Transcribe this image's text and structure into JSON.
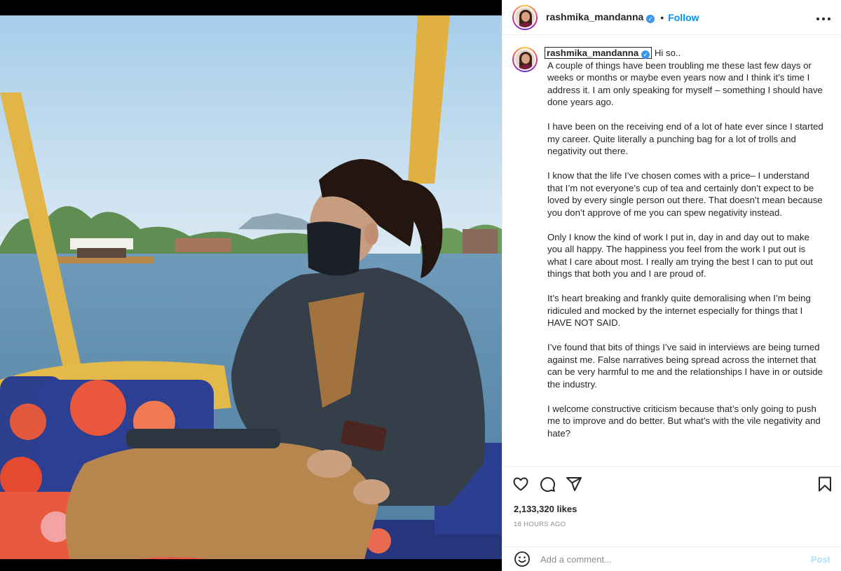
{
  "post": {
    "username": "rashmika_mandanna",
    "verified_mark": "✓",
    "dot": "•",
    "follow_label": "Follow",
    "more_icon": "more-dots-icon"
  },
  "caption": {
    "username": "rashmika_mandanna",
    "greeting": "Hi so..",
    "paragraphs": [
      "A couple of things have been troubling me these last few days or weeks or months or maybe even years now and I think it’s time I address it. I am only speaking for myself – something I should have done years ago.",
      "I have been on the receiving end of a lot of hate ever since I started my career. Quite literally a punching bag for a lot of trolls and negativity out there.",
      "I know that the life I’ve chosen comes with a price– I understand that I’m not everyone’s cup of tea and certainly don’t expect to be loved by every single person out there. That doesn’t mean because you don’t approve of me you can spew negativity instead.",
      "Only I know the kind of work I put in, day in and day out to make you all happy. The happiness you feel from the work I put out is what I care about most. I really am trying the best I can to put out things that both you and I are proud of.",
      "It’s heart breaking and frankly quite demoralising when I’m being ridiculed and mocked by the internet especially for things that I HAVE NOT SAID.",
      "I’ve found that bits of things I’ve said in interviews are being turned against me. False narratives being spread across the internet that can be very harmful to me and the relationships I have in or outside the industry.",
      "I welcome constructive criticism because that’s only going to push me to improve and do better. But what’s with the vile negativity and hate?"
    ]
  },
  "actions": {
    "like_icon": "heart-icon",
    "comment_icon": "comment-icon",
    "share_icon": "share-icon",
    "save_icon": "bookmark-icon"
  },
  "likes": "2,133,320 likes",
  "time": "18 HOURS AGO",
  "comment_box": {
    "placeholder": "Add a comment...",
    "post_label": "Post"
  },
  "colors": {
    "accent": "#0095f6",
    "post_disabled": "#b2dffc",
    "verified": "#3897f0",
    "muted": "#8e8e8e"
  }
}
